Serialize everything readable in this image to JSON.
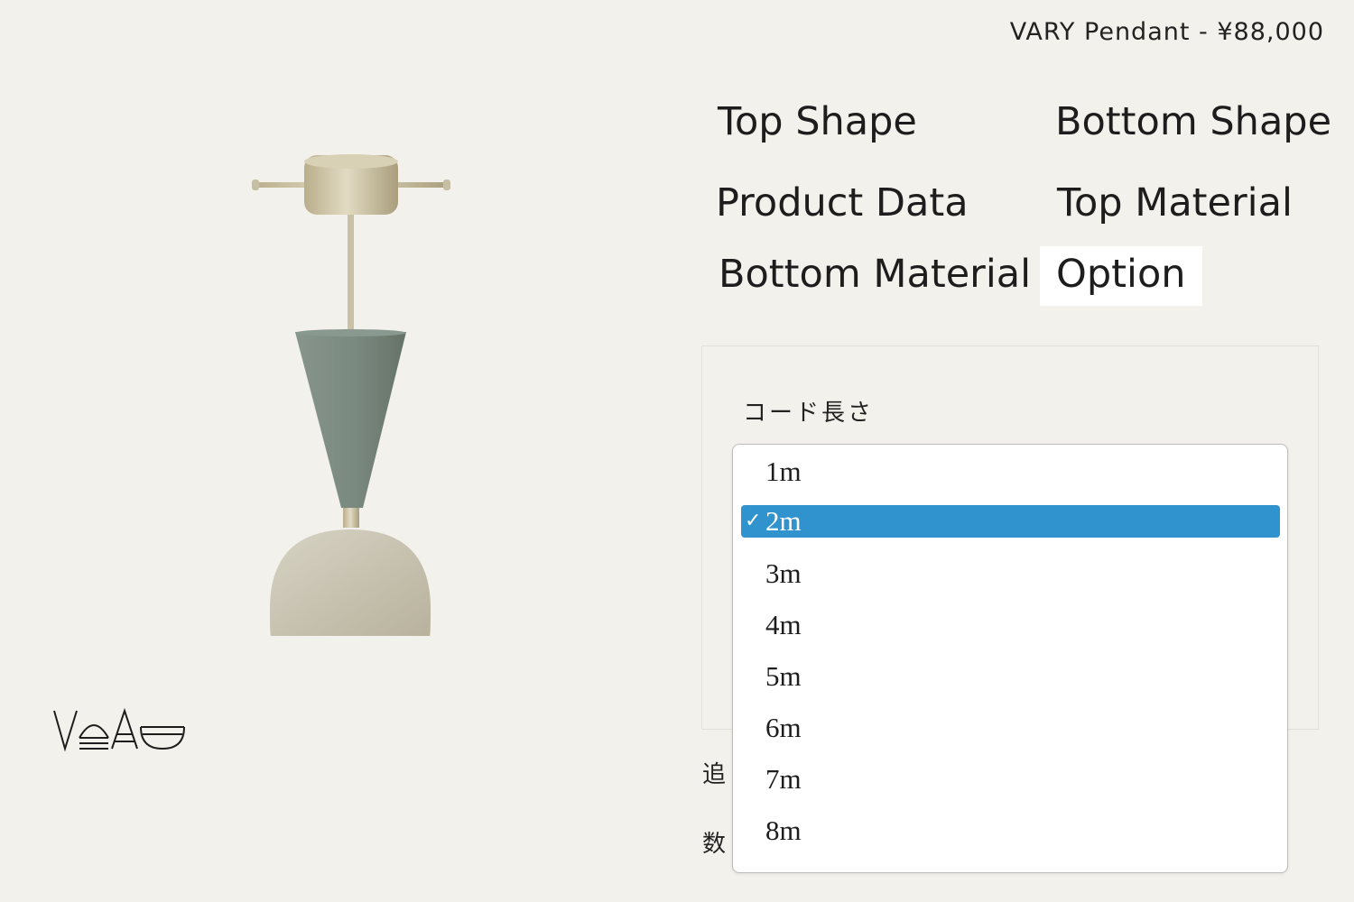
{
  "header": {
    "product_title": "VARY Pendant - ¥88,000"
  },
  "tabs": [
    {
      "label": "Top Shape",
      "active": false
    },
    {
      "label": "Bottom Shape",
      "active": false
    },
    {
      "label": "Product Data",
      "active": false
    },
    {
      "label": "Top Material",
      "active": false
    },
    {
      "label": "Bottom Material",
      "active": false
    },
    {
      "label": "Option",
      "active": true
    }
  ],
  "option_panel": {
    "cord_length_label": "コード長さ",
    "partial_label_1": "追",
    "partial_label_2": "数"
  },
  "dropdown": {
    "selected_value": "2m",
    "check_glyph": "✓",
    "options": [
      "1m",
      "2m",
      "3m",
      "4m",
      "5m",
      "6m",
      "7m",
      "8m"
    ]
  },
  "product_image": {
    "subject": "pendant lamp",
    "top_shade_color": "#76867d",
    "bottom_shade_color": "#c8c3b2",
    "hardware_color": "#cfc6aa"
  },
  "logo": {
    "text": "VaAy"
  },
  "colors": {
    "background": "#f3f1ec",
    "selection": "#3193cd",
    "panel_border": "#e2dfd8"
  }
}
